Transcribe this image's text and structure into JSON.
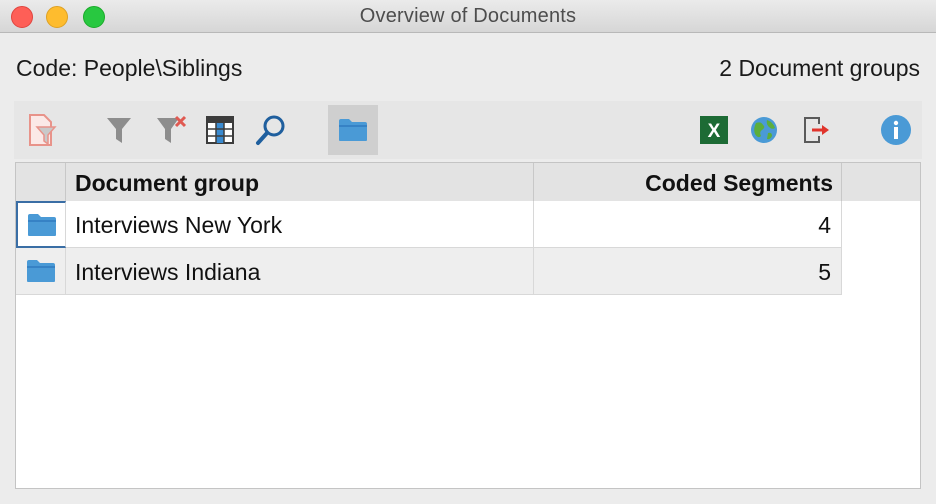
{
  "window": {
    "title": "Overview of Documents"
  },
  "info": {
    "code": "Code: People\\Siblings",
    "groups_count": "2 Document groups"
  },
  "toolbar": {
    "icons": [
      "document-filter-icon",
      "filter-icon",
      "clear-filter-icon",
      "column-chooser-icon",
      "search-icon",
      "folder-view-icon",
      "excel-export-icon",
      "web-export-icon",
      "export-icon",
      "info-icon"
    ]
  },
  "table": {
    "columns": [
      "Document group",
      "Coded Segments"
    ],
    "rows": [
      {
        "group": "Interviews New York",
        "coded": "4"
      },
      {
        "group": "Interviews Indiana",
        "coded": "5"
      }
    ]
  },
  "colors": {
    "folder": "#4a9ad6",
    "excel": "#1d6b35",
    "info": "#4a9ad6",
    "export-arrow": "#e0342c"
  }
}
